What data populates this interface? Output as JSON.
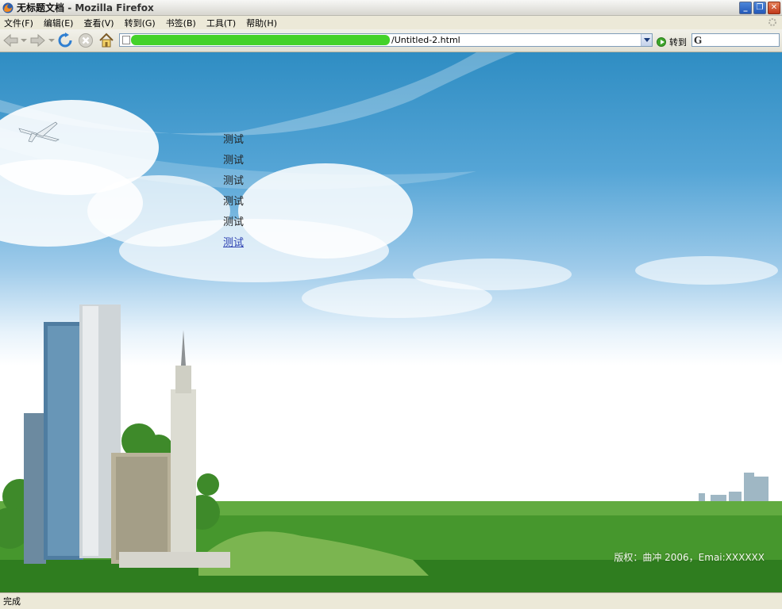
{
  "window": {
    "title": "无标题文档",
    "title_suffix": "- Mozilla Firefox"
  },
  "menu": [
    {
      "label": "文件(F)"
    },
    {
      "label": "编辑(E)"
    },
    {
      "label": "查看(V)"
    },
    {
      "label": "转到(G)"
    },
    {
      "label": "书签(B)"
    },
    {
      "label": "工具(T)"
    },
    {
      "label": "帮助(H)"
    }
  ],
  "toolbar": {
    "url_visible": "/Untitled-2.html",
    "go_label": "转到",
    "search_engine_icon": "google-icon"
  },
  "page": {
    "links": [
      {
        "label": "测试"
      },
      {
        "label": "测试"
      },
      {
        "label": "测试"
      },
      {
        "label": "测试"
      },
      {
        "label": "测试"
      },
      {
        "label": "测试"
      }
    ],
    "footer": "版权：曲冲 2006，Emai:XXXXXX"
  },
  "status": {
    "text": "完成"
  },
  "colors": {
    "sky_top": "#2f8dc3",
    "grass": "#3f8f2a",
    "link_active": "#2a3fb0"
  }
}
